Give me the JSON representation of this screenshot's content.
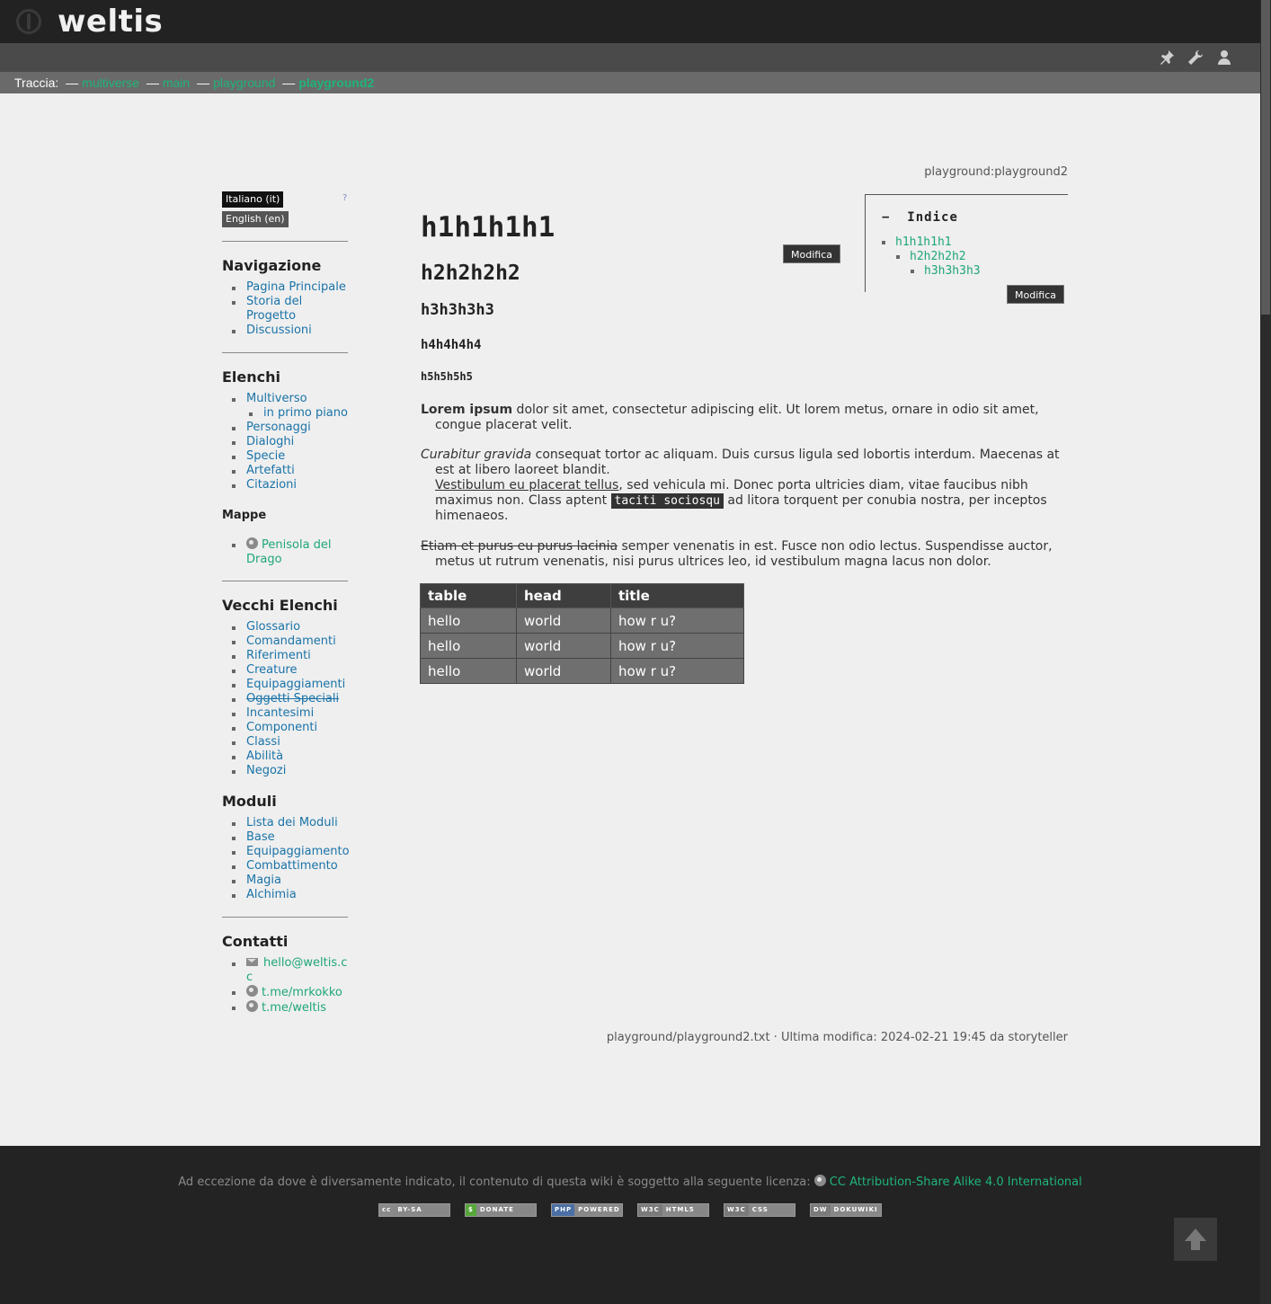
{
  "header": {
    "title": "weltis"
  },
  "breadcrumb": {
    "label": "Traccia:",
    "sep": "—",
    "items": [
      "multiverse",
      "main",
      "playground",
      "playground2"
    ]
  },
  "page_id": "playground:playground2",
  "sidebar": {
    "languages": [
      {
        "label": "Italiano (it)",
        "active": true
      },
      {
        "label": "English (en)",
        "active": false
      }
    ],
    "lang_help": "?",
    "sections": {
      "navigazione": {
        "title": "Navigazione",
        "items": [
          "Pagina Principale",
          "Storia del Progetto",
          "Discussioni"
        ]
      },
      "elenchi": {
        "title": "Elenchi",
        "items": [
          "Multiverso",
          "in primo piano",
          "Personaggi",
          "Dialoghi",
          "Specie",
          "Artefatti",
          "Citazioni"
        ]
      },
      "mappe": {
        "title": "Mappe",
        "items": [
          "Penisola del Drago"
        ]
      },
      "vecchi": {
        "title": "Vecchi Elenchi",
        "items": [
          "Glossario",
          "Comandamenti",
          "Riferimenti",
          "Creature",
          "Equipaggiamenti",
          "Oggetti Speciali",
          "Incantesimi",
          "Componenti",
          "Classi",
          "Abilità",
          "Negozi"
        ]
      },
      "moduli": {
        "title": "Moduli",
        "items": [
          "Lista dei Moduli",
          "Base",
          "Equipaggiamento",
          "Combattimento",
          "Magia",
          "Alchimia"
        ]
      },
      "contatti": {
        "title": "Contatti",
        "items": [
          "hello@weltis.cc",
          "t.me/mrkokko",
          "t.me/weltis"
        ]
      }
    }
  },
  "content": {
    "h1": "h1h1h1h1",
    "h2": "h2h2h2h2",
    "h3": "h3h3h3h3",
    "h4": "h4h4h4h4",
    "h5": "h5h5h5h5",
    "edit_label": "Modifica",
    "p1": {
      "bold": "Lorem ipsum",
      "rest": " dolor sit amet, consectetur adipiscing elit. Ut lorem metus, ornare in odio sit amet, congue placerat velit."
    },
    "p2": {
      "italic": "Curabitur gravida",
      "rest1": " consequat tortor ac aliquam. Duis cursus ligula sed lobortis interdum. Maecenas at est at libero laoreet blandit.",
      "underline": "Vestibulum eu placerat tellus",
      "rest2": ", sed vehicula mi. Donec porta ultricies diam, vitae faucibus nibh maximus non. Class aptent ",
      "code": "taciti sociosqu",
      "rest3": " ad litora torquent per conubia nostra, per inceptos himenaeos."
    },
    "p3": {
      "deleted": "Etiam et purus eu purus lacinia",
      "rest": " semper venenatis in est. Fusce non odio lectus. Suspendisse auctor, metus ut rutrum venenatis, nisi purus ultrices leo, id vestibulum magna lacus non dolor."
    },
    "table": {
      "headers": [
        "table",
        "head",
        "title"
      ],
      "rows": [
        [
          "hello",
          "world",
          "how r u?"
        ],
        [
          "hello",
          "world",
          "how r u?"
        ],
        [
          "hello",
          "world",
          "how r u?"
        ]
      ]
    }
  },
  "toc": {
    "toggle": "−",
    "title": "Indice",
    "items": [
      "h1h1h1h1",
      "h2h2h2h2",
      "h3h3h3h3"
    ]
  },
  "docinfo": "playground/playground2.txt · Ultima modifica: 2024-02-21 19:45 da storyteller",
  "footer": {
    "license_text": "Ad eccezione da dove è diversamente indicato, il contenuto di questa wiki è soggetto alla seguente licenza:",
    "license_link": "CC Attribution-Share Alike 4.0 International",
    "badges": [
      {
        "pre": "cc",
        "text": "BY-SA",
        "color": "#8a8a8a"
      },
      {
        "pre": "$",
        "text": "DONATE",
        "color": "#57a63a"
      },
      {
        "pre": "PHP",
        "text": "POWERED",
        "color": "#4a6fa5"
      },
      {
        "pre": "W3C",
        "text": "HTML5",
        "color": "#7a7a7a"
      },
      {
        "pre": "W3C",
        "text": "CSS",
        "color": "#7a7a7a"
      },
      {
        "pre": "DW",
        "text": "DOKUWIKI",
        "color": "#7a7a7a"
      }
    ]
  },
  "colors": {
    "accent": "#1fb47a",
    "link": "#1a73a8",
    "header_bg": "#222222"
  }
}
